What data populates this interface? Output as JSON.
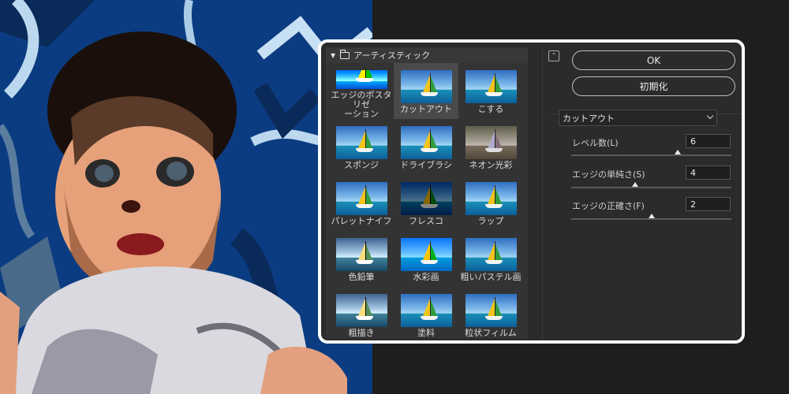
{
  "gallery": {
    "category": "アーティスティック",
    "filters": [
      {
        "label": "エッジのポスタリゼ\nーション",
        "style": "posterize",
        "selected": false
      },
      {
        "label": "カットアウト",
        "style": "normal",
        "selected": true
      },
      {
        "label": "こする",
        "style": "normal",
        "selected": false
      },
      {
        "label": "スポンジ",
        "style": "normal",
        "selected": false
      },
      {
        "label": "ドライブラシ",
        "style": "normal",
        "selected": false
      },
      {
        "label": "ネオン光彩",
        "style": "neon",
        "selected": false
      },
      {
        "label": "パレットナイフ",
        "style": "normal",
        "selected": false
      },
      {
        "label": "フレスコ",
        "style": "dark",
        "selected": false
      },
      {
        "label": "ラップ",
        "style": "normal",
        "selected": false
      },
      {
        "label": "色鉛筆",
        "style": "sketch",
        "selected": false
      },
      {
        "label": "水彩画",
        "style": "water",
        "selected": false
      },
      {
        "label": "粗いパステル画",
        "style": "normal",
        "selected": false
      },
      {
        "label": "粗描き",
        "style": "sketch",
        "selected": false
      },
      {
        "label": "塗料",
        "style": "normal",
        "selected": false
      },
      {
        "label": "粒状フィルム",
        "style": "normal",
        "selected": false
      }
    ]
  },
  "buttons": {
    "ok": "OK",
    "reset": "初期化"
  },
  "filter_select": {
    "value": "カットアウト"
  },
  "params": {
    "levels": {
      "label": "レベル数(L)",
      "value": "6",
      "min": 2,
      "max": 8
    },
    "simplicity": {
      "label": "エッジの単純さ(S)",
      "value": "4",
      "min": 0,
      "max": 10
    },
    "fidelity": {
      "label": "エッジの正確さ(F)",
      "value": "2",
      "min": 1,
      "max": 3
    }
  },
  "colors": {
    "dialog_bg": "#2b2b2b",
    "dialog_border": "#ffffff",
    "preview_blue": "#0d3f86"
  }
}
